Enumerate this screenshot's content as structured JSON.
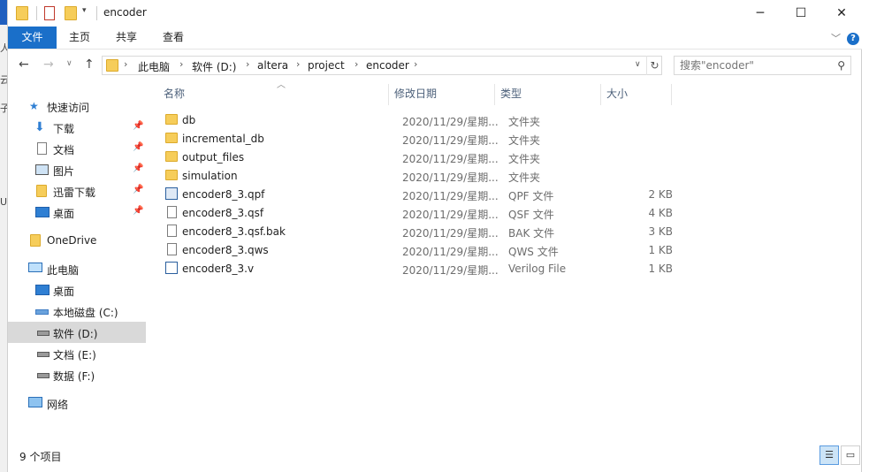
{
  "window": {
    "title": "encoder"
  },
  "ribbon": {
    "tabs": [
      "文件",
      "主页",
      "共享",
      "查看"
    ]
  },
  "address": {
    "crumbs": [
      "此电脑",
      "软件 (D:)",
      "altera",
      "project",
      "encoder"
    ],
    "search_placeholder": "搜索\"encoder\""
  },
  "nav": {
    "quick_access": "快速访问",
    "pinned": [
      "下载",
      "文档",
      "图片",
      "迅雷下载",
      "桌面"
    ],
    "onedrive": "OneDrive",
    "this_pc": "此电脑",
    "pc_items": [
      "桌面",
      "本地磁盘 (C:)",
      "软件 (D:)",
      "文档 (E:)",
      "数据 (F:)"
    ],
    "network": "网络"
  },
  "columns": {
    "name": "名称",
    "date": "修改日期",
    "type": "类型",
    "size": "大小"
  },
  "files": [
    {
      "name": "db",
      "date": "2020/11/29/星期...",
      "type": "文件夹",
      "size": "",
      "icon": "folder-icon"
    },
    {
      "name": "incremental_db",
      "date": "2020/11/29/星期...",
      "type": "文件夹",
      "size": "",
      "icon": "folder-icon"
    },
    {
      "name": "output_files",
      "date": "2020/11/29/星期...",
      "type": "文件夹",
      "size": "",
      "icon": "folder-icon"
    },
    {
      "name": "simulation",
      "date": "2020/11/29/星期...",
      "type": "文件夹",
      "size": "",
      "icon": "folder-icon"
    },
    {
      "name": "encoder8_3.qpf",
      "date": "2020/11/29/星期...",
      "type": "QPF 文件",
      "size": "2 KB",
      "icon": "quartus-project-icon"
    },
    {
      "name": "encoder8_3.qsf",
      "date": "2020/11/29/星期...",
      "type": "QSF 文件",
      "size": "4 KB",
      "icon": "document-icon"
    },
    {
      "name": "encoder8_3.qsf.bak",
      "date": "2020/11/29/星期...",
      "type": "BAK 文件",
      "size": "3 KB",
      "icon": "document-icon"
    },
    {
      "name": "encoder8_3.qws",
      "date": "2020/11/29/星期...",
      "type": "QWS 文件",
      "size": "1 KB",
      "icon": "document-icon"
    },
    {
      "name": "encoder8_3.v",
      "date": "2020/11/29/星期...",
      "type": "Verilog File",
      "size": "1 KB",
      "icon": "verilog-file-icon"
    }
  ],
  "status": {
    "item_count": "9 个项目"
  },
  "left_strip": [
    "人",
    "子",
    "云",
    "U"
  ]
}
